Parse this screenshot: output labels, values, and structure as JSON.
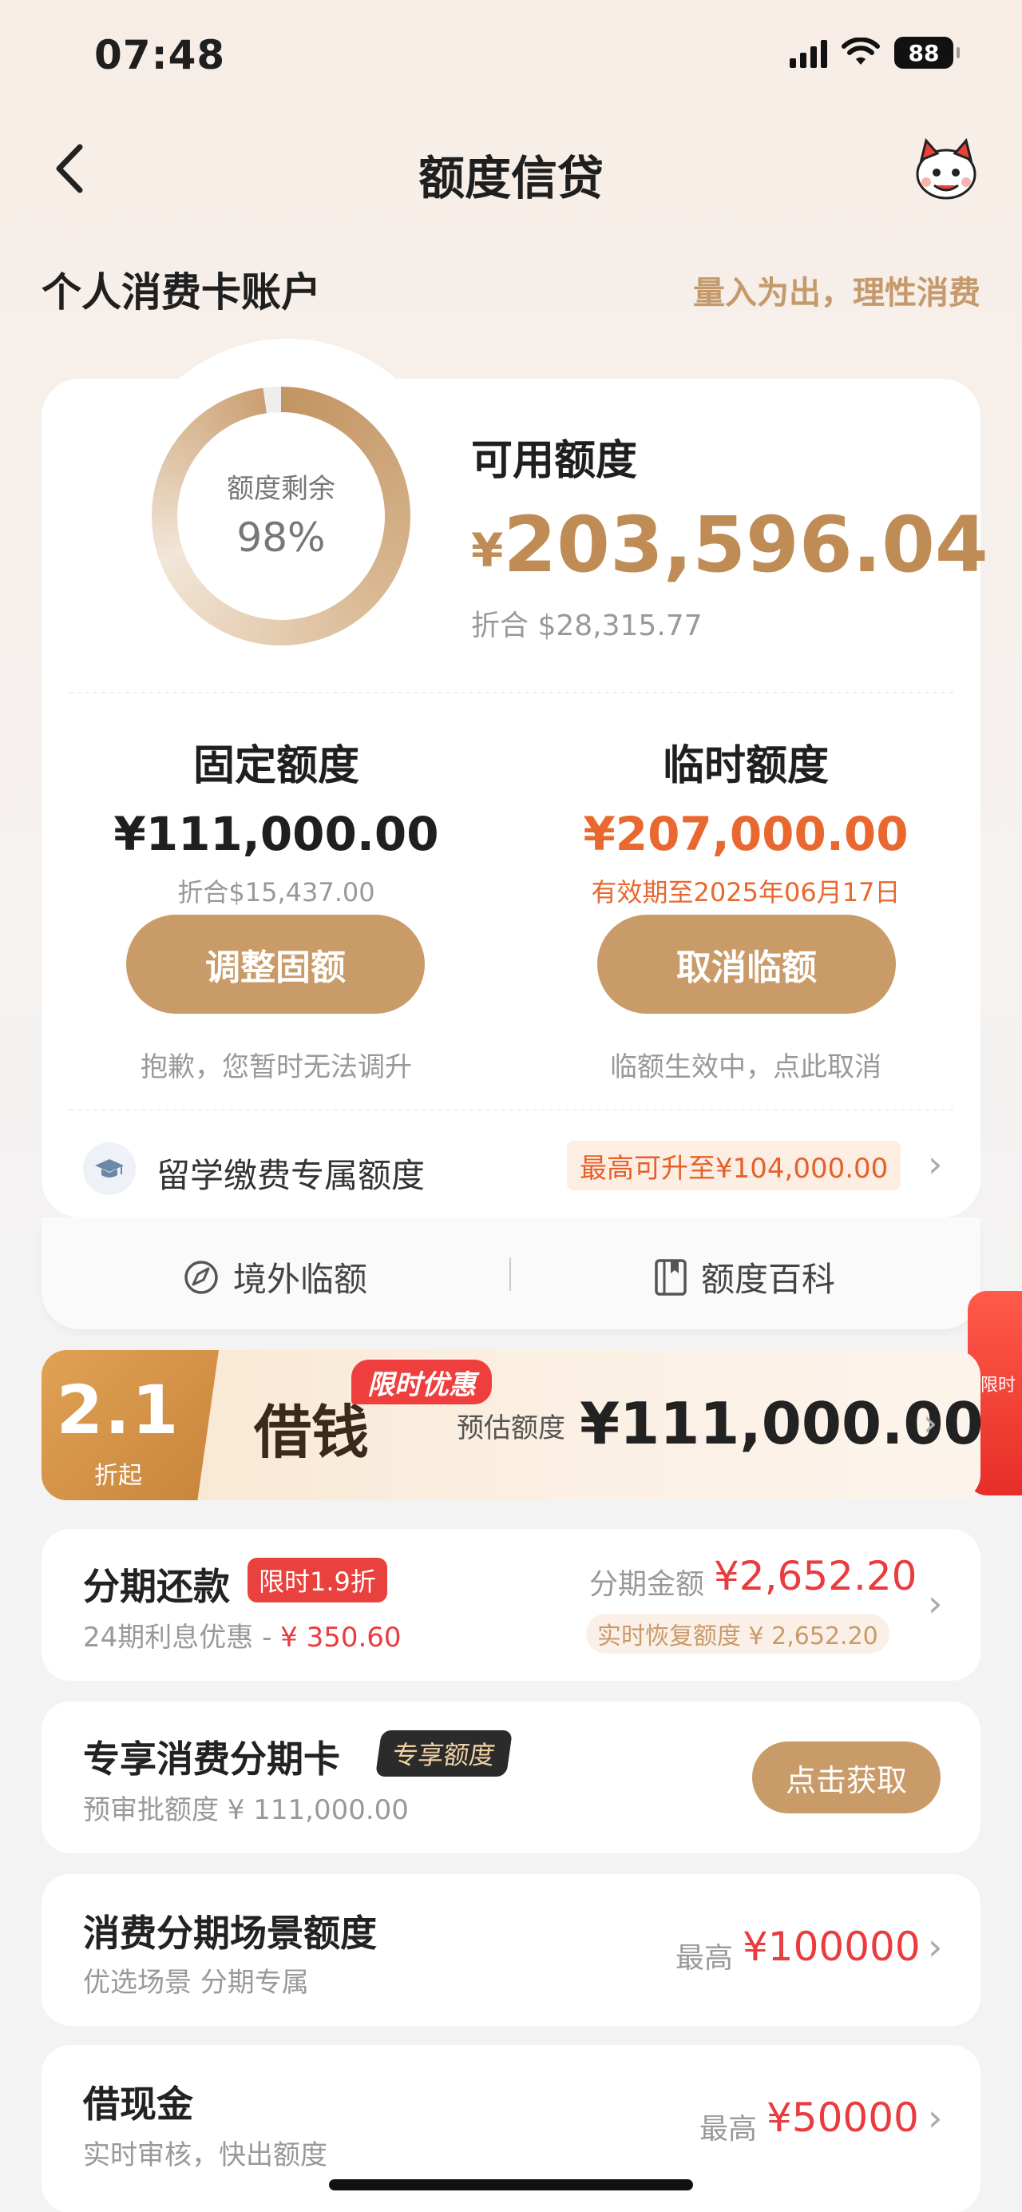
{
  "status": {
    "time": "07:48",
    "battery": "88"
  },
  "nav": {
    "title": "额度信贷"
  },
  "account": {
    "title": "个人消费卡账户",
    "slogan": "量入为出，理性消费"
  },
  "summary": {
    "ring_label": "额度剩余",
    "ring_value": "98%",
    "ring_fraction": 0.98,
    "available_label": "可用额度",
    "available_symbol": "¥",
    "available_amount": "203,596.04",
    "converted": "折合 $28,315.77"
  },
  "fixed": {
    "title": "固定额度",
    "amount": "¥111,000.00",
    "sub": "折合$15,437.00",
    "button": "调整固额",
    "note": "抱歉，您暂时无法调升"
  },
  "temporary": {
    "title": "临时额度",
    "amount": "¥207,000.00",
    "sub": "有效期至2025年06月17日",
    "button": "取消临额",
    "note": "临额生效中，点此取消"
  },
  "study": {
    "label": "留学缴费专属额度",
    "tag": "最高可升至¥104,000.00"
  },
  "sub_links": {
    "overseas": "境外临额",
    "wiki": "额度百科"
  },
  "side_tab": {
    "text": "限时"
  },
  "banner": {
    "discount": "2.1",
    "discount_sub": "折起",
    "title": "借钱",
    "badge": "限时优惠",
    "estimate_label": "预估额度",
    "estimate_amount": "¥111,000.00"
  },
  "installment": {
    "title": "分期还款",
    "tag": "限时1.9折",
    "sub_prefix": "24期利息优惠 - ",
    "sub_amount": "¥ 350.60",
    "amount_label": "分期金额",
    "amount": "¥2,652.20",
    "recover": "实时恢复额度 ¥ 2,652.20"
  },
  "exclusive": {
    "title": "专享消费分期卡",
    "tag": "专享额度",
    "sub": "预审批额度 ¥ 111,000.00",
    "button": "点击获取"
  },
  "scene": {
    "title": "消费分期场景额度",
    "sub": "优选场景 分期专属",
    "max_label": "最高",
    "max_amount": "¥100000"
  },
  "cash": {
    "title": "借现金",
    "sub": "实时审核，快出额度",
    "max_label": "最高",
    "max_amount": "¥50000"
  },
  "colors": {
    "accent_gold": "#c99b69",
    "price_red": "#ea3b3f",
    "temp_orange": "#e9682f"
  }
}
